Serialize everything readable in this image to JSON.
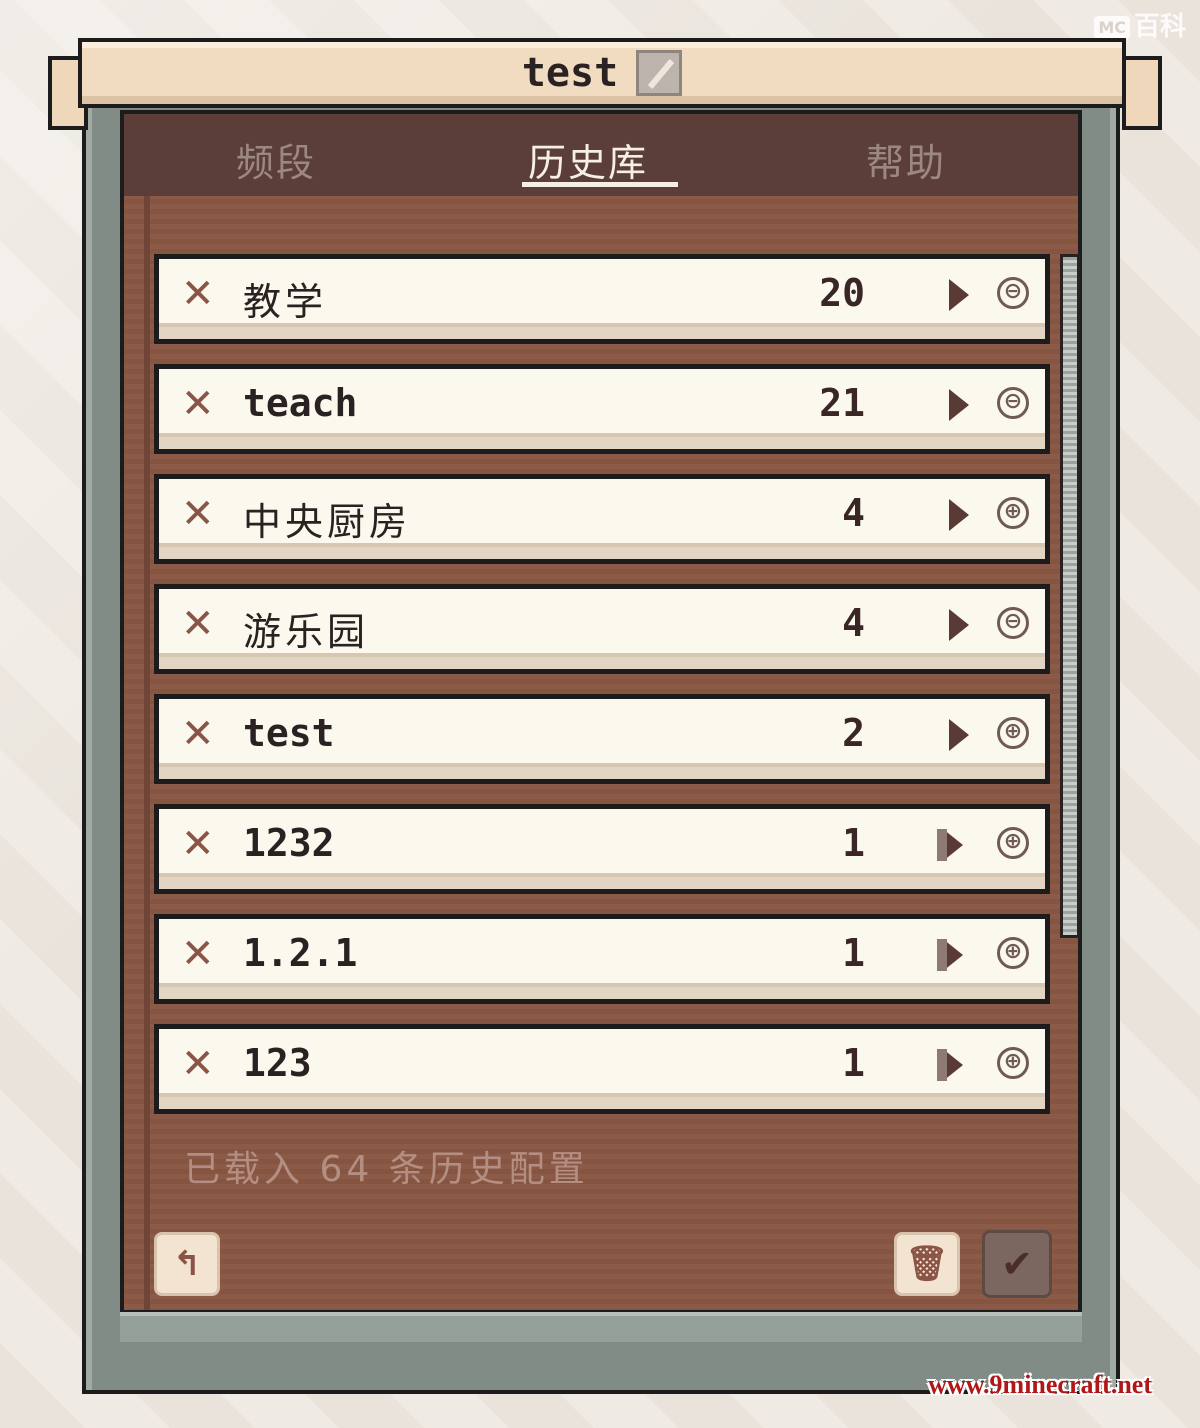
{
  "watermarks": {
    "top_logo": "MC",
    "top": "百科",
    "bottom": "www.9minecraft.net"
  },
  "title": {
    "text": "test",
    "edit_icon": "pencil-icon"
  },
  "tabs": [
    {
      "label": "频段",
      "active": false
    },
    {
      "label": "历史库",
      "active": true
    },
    {
      "label": "帮助",
      "active": false
    }
  ],
  "history": [
    {
      "name": "教学",
      "count": "20",
      "toggle": "⊖",
      "toggle_icon": "minus-circle-icon"
    },
    {
      "name": "teach",
      "count": "21",
      "toggle": "⊖",
      "toggle_icon": "minus-circle-icon"
    },
    {
      "name": "中央厨房",
      "count": "4",
      "toggle": "⊕",
      "toggle_icon": "plus-circle-icon"
    },
    {
      "name": "游乐园",
      "count": "4",
      "toggle": "⊖",
      "toggle_icon": "minus-circle-icon"
    },
    {
      "name": "test",
      "count": "2",
      "toggle": "⊕",
      "toggle_icon": "plus-circle-icon"
    },
    {
      "name": "1232",
      "count": "1",
      "toggle": "⊕",
      "toggle_icon": "plus-circle-icon"
    },
    {
      "name": "1.2.1",
      "count": "1",
      "toggle": "⊕",
      "toggle_icon": "plus-circle-icon"
    },
    {
      "name": "123",
      "count": "1",
      "toggle": "⊕",
      "toggle_icon": "plus-circle-icon"
    }
  ],
  "status": "已载入 64 条历史配置",
  "buttons": {
    "back": "↰",
    "trash": "🗑",
    "confirm": "✔"
  },
  "colors": {
    "panel": "#8c5a49",
    "tab_bar": "#5c3e39",
    "row_bg": "#fbf8ee",
    "delete_x": "#8a5446",
    "banner": "#f2dcc1"
  }
}
